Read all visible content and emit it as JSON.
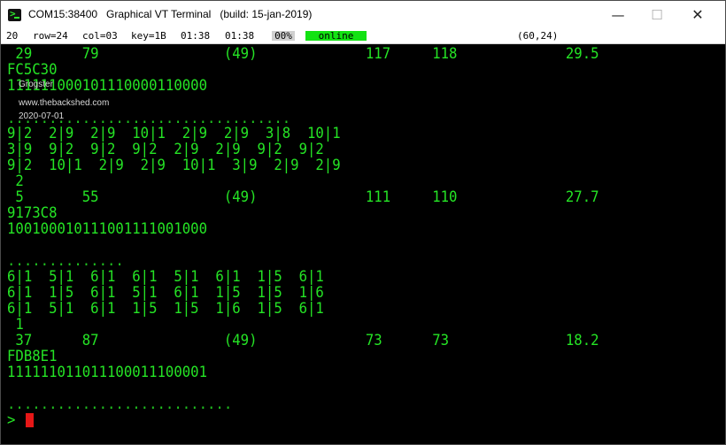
{
  "window": {
    "title": "COM15:38400   Graphical VT Terminal   (build: 15-jan-2019)",
    "controls": {
      "minimize": "—",
      "maximize": "☐",
      "close": "✕"
    }
  },
  "status": {
    "items": [
      "20",
      "row=24",
      "col=03",
      "key=1B",
      "01:38",
      "01:38"
    ],
    "percent": "00%",
    "connection": "online",
    "cursor_pos": "(60,24)"
  },
  "watermark": {
    "author": "Grogster",
    "site": "www.thebackshed.com",
    "date": "2020-07-01"
  },
  "terminal": {
    "lines": [
      " 29      79               (49)             117     118             29.5",
      "FC5C30",
      "111111000101110000110000",
      "..................................",
      "9|2  2|9  2|9  10|1  2|9  2|9  3|8  10|1",
      "3|9  9|2  9|2  9|2  2|9  2|9  9|2  9|2",
      "9|2  10|1  2|9  2|9  10|1  3|9  2|9  2|9",
      " 2",
      " 5       55               (49)             111     110             27.7",
      "9173C8",
      "100100010111001111001000",
      "",
      "..............",
      "6|1  5|1  6|1  6|1  5|1  6|1  1|5  6|1",
      "6|1  1|5  6|1  5|1  6|1  1|5  1|5  1|6",
      "6|1  5|1  6|1  1|5  1|5  1|6  1|5  6|1",
      " 1",
      " 37      87               (49)             73      73              18.2",
      "FDB8E1",
      "111111011011100011100001",
      "",
      "...........................",
      ">"
    ]
  },
  "colors": {
    "terminal_fg": "#25e425",
    "terminal_bg": "#000000",
    "online_badge": "#13e213",
    "cursor": "#e61717"
  }
}
